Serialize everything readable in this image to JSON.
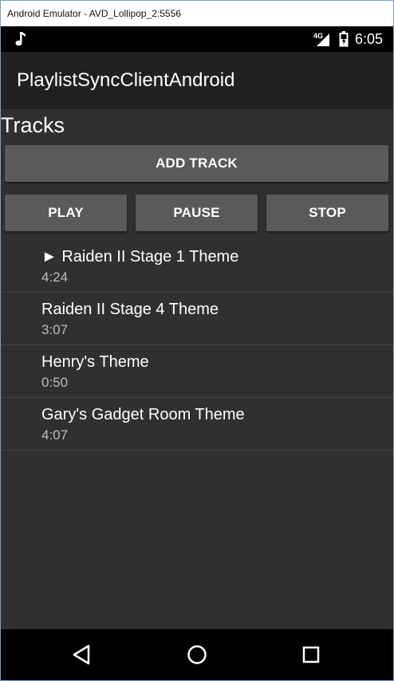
{
  "window": {
    "title": "Android Emulator - AVD_Lollipop_2:5556"
  },
  "statusbar": {
    "network": "4G",
    "time": "6:05",
    "icons": [
      "music-note-icon",
      "signal-icon",
      "battery-icon"
    ]
  },
  "appbar": {
    "title": "PlaylistSyncClientAndroid"
  },
  "main": {
    "heading": "Tracks",
    "add_button_label": "ADD TRACK",
    "controls": {
      "play_label": "PLAY",
      "pause_label": "PAUSE",
      "stop_label": "STOP"
    },
    "tracks": [
      {
        "title": "► Raiden II Stage 1 Theme",
        "duration": "4:24"
      },
      {
        "title": "Raiden II Stage 4 Theme",
        "duration": "3:07"
      },
      {
        "title": "Henry's Theme",
        "duration": "0:50"
      },
      {
        "title": "Gary's Gadget Room Theme",
        "duration": "4:07"
      }
    ]
  },
  "navbar": {
    "icons": [
      "back-icon",
      "home-icon",
      "recents-icon"
    ]
  },
  "colors": {
    "background": "#303030",
    "appbar": "#212121",
    "button": "#5a5a5a",
    "text": "#ffffff",
    "secondary_text": "#bdbdbd"
  }
}
